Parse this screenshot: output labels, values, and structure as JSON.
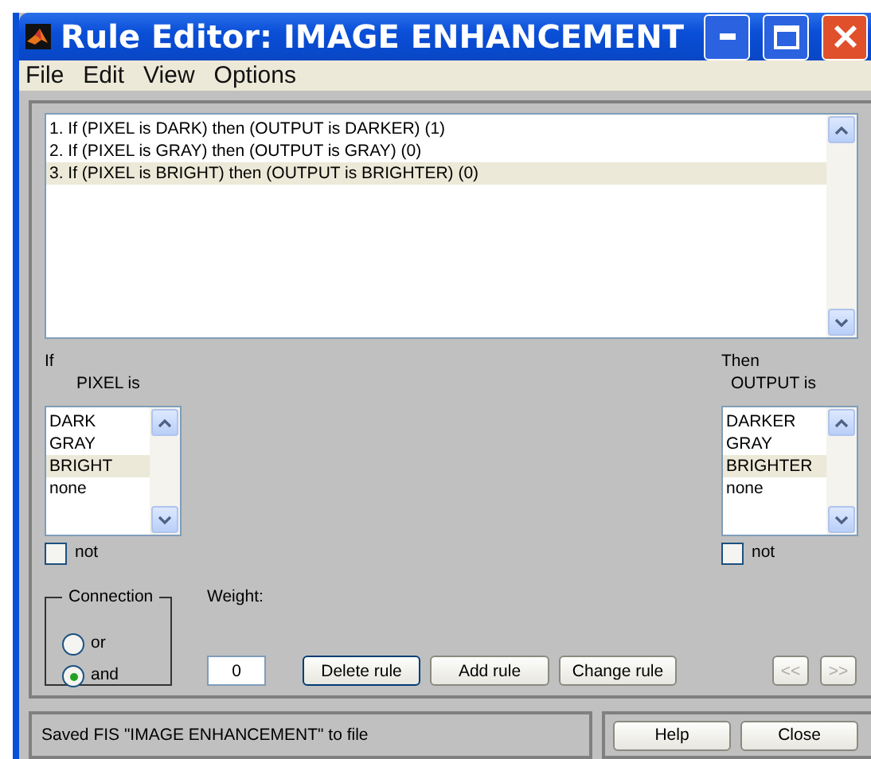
{
  "window": {
    "title": "Rule Editor: IMAGE ENHANCEMENT"
  },
  "menu": [
    "File",
    "Edit",
    "View",
    "Options"
  ],
  "rules": [
    {
      "text": "1. If (PIXEL is DARK) then (OUTPUT is DARKER) (1)",
      "selected": false
    },
    {
      "text": "2. If (PIXEL is GRAY) then (OUTPUT is GRAY) (0)",
      "selected": false
    },
    {
      "text": "3. If (PIXEL is BRIGHT) then (OUTPUT is BRIGHTER) (0)",
      "selected": true
    }
  ],
  "antecedent": {
    "heading": "If",
    "variable": "PIXEL is",
    "terms": [
      {
        "label": "DARK",
        "selected": false
      },
      {
        "label": "GRAY",
        "selected": false
      },
      {
        "label": "BRIGHT",
        "selected": true
      },
      {
        "label": "none",
        "selected": false
      }
    ],
    "not_label": "not",
    "not_checked": false
  },
  "consequent": {
    "heading": "Then",
    "variable": "OUTPUT is",
    "terms": [
      {
        "label": "DARKER",
        "selected": false
      },
      {
        "label": "GRAY",
        "selected": false
      },
      {
        "label": "BRIGHTER",
        "selected": true
      },
      {
        "label": "none",
        "selected": false
      }
    ],
    "not_label": "not",
    "not_checked": false
  },
  "connection": {
    "title": "Connection",
    "options": [
      {
        "label": "or",
        "selected": false
      },
      {
        "label": "and",
        "selected": true
      }
    ]
  },
  "weight": {
    "label": "Weight:",
    "value": "0"
  },
  "rule_buttons": [
    {
      "label": "Delete rule",
      "kind": "default"
    },
    {
      "label": "Add rule",
      "kind": "normal"
    },
    {
      "label": "Change rule",
      "kind": "normal"
    }
  ],
  "nav_buttons": [
    {
      "label": "<<",
      "disabled": true
    },
    {
      "label": ">>",
      "disabled": true
    }
  ],
  "status": "Saved FIS \"IMAGE ENHANCEMENT\" to file",
  "footer_buttons": [
    "Help",
    "Close"
  ]
}
